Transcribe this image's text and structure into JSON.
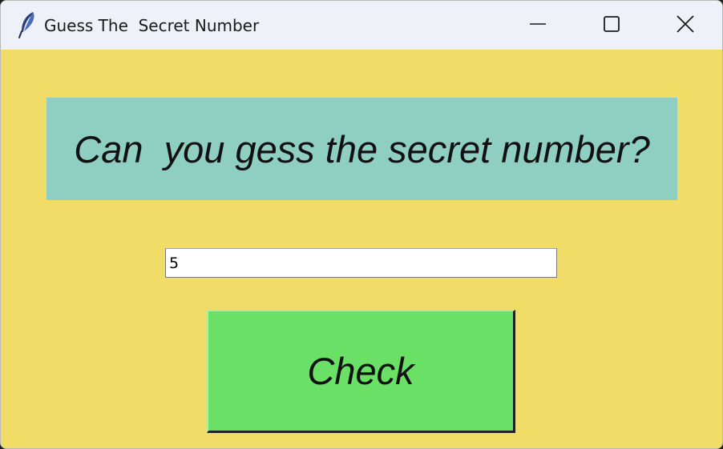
{
  "window": {
    "title": "Guess The  Secret Number",
    "app_icon": "feather-icon",
    "controls": {
      "minimize_icon": "minimize-icon",
      "maximize_icon": "maximize-icon",
      "close_icon": "close-icon"
    }
  },
  "main": {
    "question": "Can  you gess the secret number?",
    "guess_value": "5",
    "check_label": "Check"
  },
  "colors": {
    "background": "#f1dc68",
    "label_background": "#8fcfc1",
    "button_background": "#6ae067",
    "titlebar": "#eff1f8"
  }
}
